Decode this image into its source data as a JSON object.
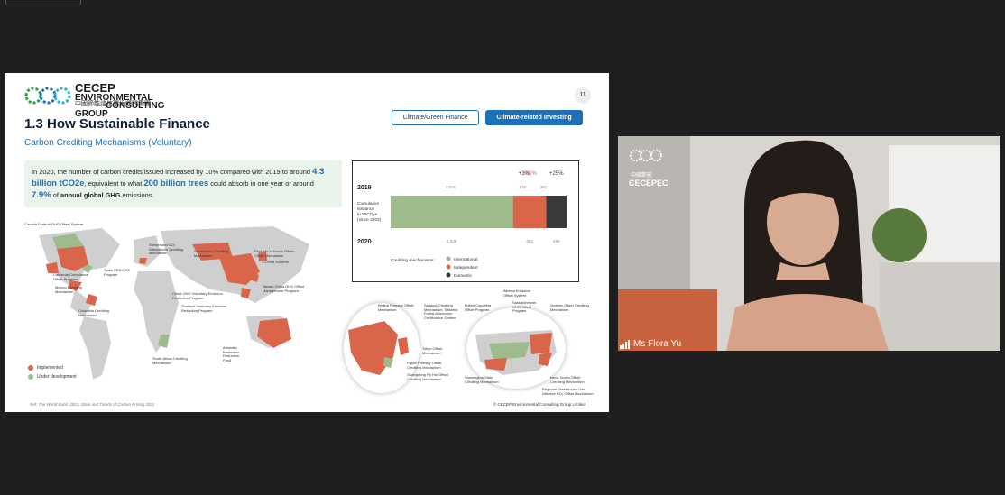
{
  "slide": {
    "logo_en_line1": "CECEP",
    "logo_en_line2": "ENVIRONMENTAL",
    "logo_en_line3": "CONSULTING GROUP",
    "logo_cn": "中國節能諮信環境顧問集團",
    "page_number": "11",
    "tab_climate_green": "Climate/Green Finance",
    "tab_climate_related": "Climate-related Investing",
    "title": "1.3 How Sustainable Finance",
    "subtitle": "Carbon Crediting Mechanisms (Voluntary)",
    "info_text": {
      "p1": "In 2020, the number of carbon credits issued increased by 10% compared with 2019 to around",
      "hl1": "4.3 billion tCO2e",
      "p2": ", equivalent to what",
      "hl2": "200 billion trees",
      "p3": "could absorb in one year or around",
      "hl3": "7.9%",
      "p4": "of",
      "b1": "annual global GHG",
      "p5": "emissions."
    },
    "map_labels": {
      "canada": "Canada Federal GHG Offset System",
      "kazakhstan": "Kazakhstan Crediting Mechanism",
      "switzerland": "Switzerland CO₂ Attestations Crediting Mechanism",
      "korea": "Republic of Korea Offset Credit Mechanism",
      "jcm": "Joint Crediting Mechanism",
      "jcredit": "J-Credit Scheme",
      "spain": "Spain FES-CO2 Program",
      "california": "California Compliance Offset Program",
      "mexico": "Mexico Crediting Mechanism",
      "china": "China GHG Voluntary Emission Reduction Program",
      "taiwan": "Taiwan China GHG Offset Management Program",
      "thailand": "Thailand Voluntary Emission Reduction Program",
      "colombia": "Colombia Crediting Mechanism",
      "australia": "Australia Emissions Reduction Fund",
      "south_africa": "South Africa Crediting Mechanism",
      "beijing": "Beijing Forestry Offset Mechanism",
      "saitama": "Saitama Crediting Mechanism, Saitama Forest Absorption Certification System",
      "tokyo": "Tokyo Offset Mechanism",
      "fujian": "Fujian Forestry Offset Crediting Mechanism",
      "guangdong": "Guangdong Pu Hui Offset Crediting Mechanism",
      "bc": "British Columbia Offset Program",
      "alberta": "Alberta Emission Offset System",
      "saskatchewan": "Saskatchewan GHG Offset Program",
      "quebec": "Québec Offset Crediting Mechanism",
      "washington": "Washington State Crediting Mechanism",
      "nova_scotia": "Nova Scotia Offset Crediting Mechanism",
      "rggi": "Regional Greenhouse Gas Initiative CO₂ Offset Mechanism"
    },
    "legend_implemented": "Implemented",
    "legend_under_dev": "Under development",
    "reference": "Ref: The World Bank, 2021, State and Trends of Carbon Pricing 2021",
    "copyright": "© CECEP Environmental Consulting Group Limited"
  },
  "chart_data": {
    "type": "bar",
    "orientation": "horizontal-stacked",
    "categories": [
      "2019",
      "2020"
    ],
    "series": [
      {
        "name": "International",
        "values": [
          2874,
          2948
        ],
        "color": "#9fbb8c"
      },
      {
        "name": "Independent",
        "values": [
          616,
          803
        ],
        "color": "#d9654a"
      },
      {
        "name": "Domestic",
        "values": [
          391,
          488
        ],
        "color": "#3a3a3a"
      }
    ],
    "changes": [
      "+3%",
      "+30%",
      "+25%"
    ],
    "axis_label": "Cumulative issuance in MtCO₂e (since 2002)",
    "legend_title": "Crediting mechanisms:"
  },
  "video": {
    "logo_cn": "中國節能",
    "logo_en": "CECEPEC",
    "participant_name": "Ms Flora Yu"
  },
  "colors": {
    "implemented": "#d9654a",
    "under_development": "#9fbb8c",
    "accent": "#1e6fb3"
  }
}
